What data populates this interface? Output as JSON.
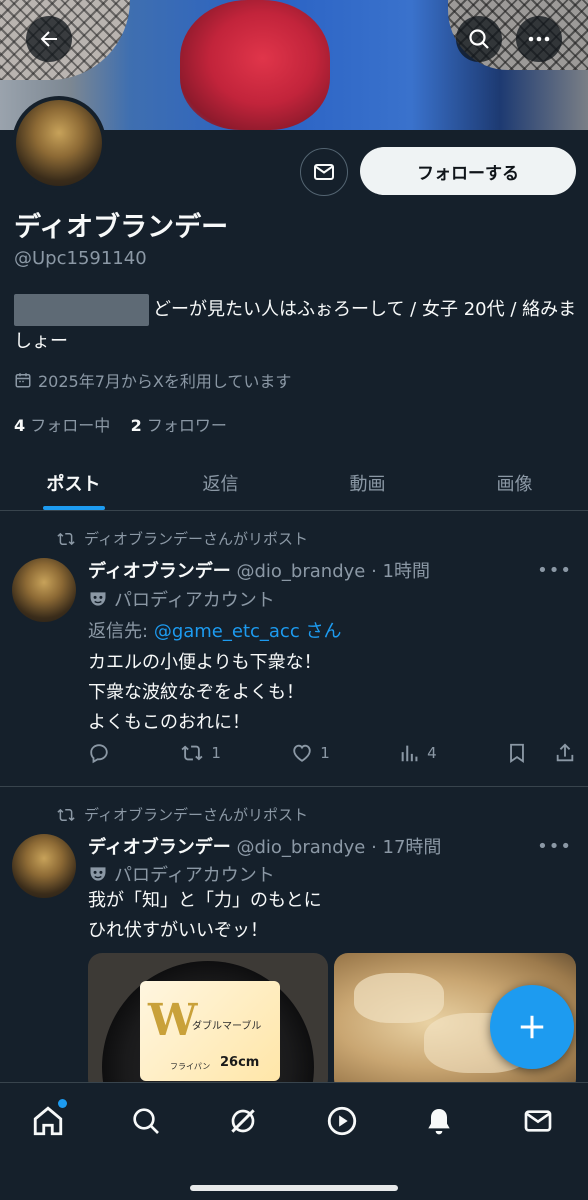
{
  "profile": {
    "display_name": "ディオブランデー",
    "handle": "@Upc1591140",
    "bio": "どーが見たい人はふぉろーして / 女子 20代 / 絡みましょー",
    "joined": "2025年7月からXを利用しています",
    "following_count": "4",
    "following_label": "フォロー中",
    "followers_count": "2",
    "followers_label": "フォロワー",
    "follow_button": "フォローする"
  },
  "tabs": [
    {
      "label": "ポスト",
      "active": true
    },
    {
      "label": "返信",
      "active": false
    },
    {
      "label": "動画",
      "active": false
    },
    {
      "label": "画像",
      "active": false
    }
  ],
  "posts": [
    {
      "repost_label": "ディオブランデーさんがリポスト",
      "author": "ディオブランデー",
      "handle_time": "@dio_brandye · 1時間",
      "parody": "パロディアカウント",
      "reply_prefix": "返信先:",
      "reply_target": "@game_etc_acc さん",
      "text": "カエルの小便よりも下衆な！\n下衆な波紋なぞをよくも！\nよくもこのおれに！",
      "replies": "",
      "reposts": "1",
      "likes": "1",
      "views": "4"
    },
    {
      "repost_label": "ディオブランデーさんがリポスト",
      "author": "ディオブランデー",
      "handle_time": "@dio_brandye · 17時間",
      "parody": "パロディアカウント",
      "text": "我が「知」と「力」のもとに\nひれ伏すがいいぞッ！",
      "media_pan_brand": "ダブルマーブル",
      "media_pan_size": "26cm",
      "media_pan_type": "フライパン"
    }
  ],
  "colors": {
    "accent": "#1d9bf0",
    "background": "#15202b",
    "muted": "#8b98a5"
  }
}
